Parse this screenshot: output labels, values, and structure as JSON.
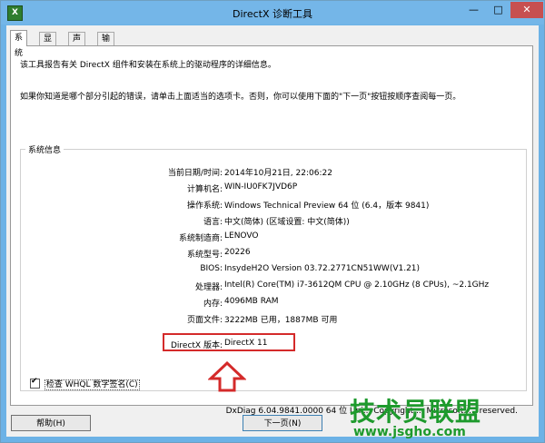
{
  "window": {
    "title": "DirectX 诊断工具",
    "icon_label": "X",
    "controls": {
      "minimize": "—",
      "maximize": "□",
      "close": "✕"
    }
  },
  "tabs": [
    {
      "label": "系统",
      "active": true
    },
    {
      "label": "显示",
      "active": false
    },
    {
      "label": "声音",
      "active": false
    },
    {
      "label": "输入",
      "active": false
    }
  ],
  "intro": {
    "line1": "该工具报告有关 DirectX 组件和安装在系统上的驱动程序的详细信息。",
    "line2": "如果你知道是哪个部分引起的错误，请单击上面适当的选项卡。否则，你可以使用下面的\"下一页\"按钮按顺序查阅每一页。"
  },
  "system_info": {
    "legend": "系统信息",
    "rows": [
      {
        "label": "当前日期/时间:",
        "value": "2014年10月21日, 22:06:22"
      },
      {
        "label": "计算机名:",
        "value": "WIN-IU0FK7JVD6P"
      },
      {
        "label": "操作系统:",
        "value": "Windows Technical Preview 64 位 (6.4，版本 9841)"
      },
      {
        "label": "语言:",
        "value": "中文(简体) (区域设置: 中文(简体))"
      },
      {
        "label": "系统制造商:",
        "value": "LENOVO"
      },
      {
        "label": "系统型号:",
        "value": "20226"
      },
      {
        "label": "BIOS:",
        "value": "InsydeH2O Version 03.72.2771CN51WW(V1.21)"
      },
      {
        "label": "处理器:",
        "value": "Intel(R) Core(TM) i7-3612QM CPU @ 2.10GHz (8 CPUs), ~2.1GHz"
      },
      {
        "label": "内存:",
        "value": "4096MB RAM"
      },
      {
        "label": "页面文件:",
        "value": "3222MB 已用，1887MB 可用"
      },
      {
        "label": "DirectX 版本:",
        "value": "DirectX 11"
      }
    ]
  },
  "whql": {
    "label": "检查 WHQL 数字签名(C)",
    "checked": true,
    "check_glyph": "✔"
  },
  "footer_version": "DxDiag 6.04.9841.0000 64 位 Uni... Copyright ... Microsoft. ... reserved.",
  "watermark": {
    "text": "技术员联盟",
    "url": "www.jsgho.com"
  },
  "buttons": {
    "help": "帮助(H)",
    "next": "下一页(N)"
  },
  "colors": {
    "titlebar": "#74b6e8",
    "highlight": "#d42a2a",
    "watermark": "#1e9a2d"
  }
}
